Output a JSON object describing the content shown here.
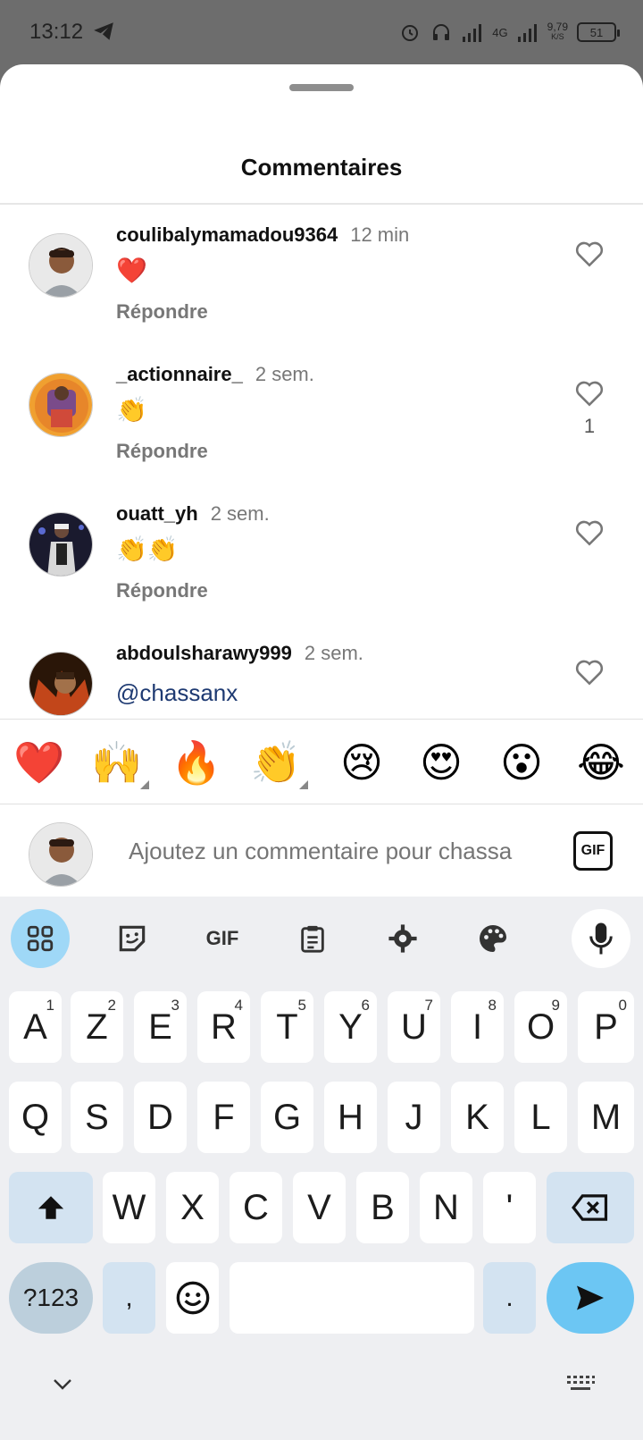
{
  "status_bar": {
    "time": "13:12",
    "network": "4G",
    "speed_value": "9,79",
    "speed_unit": "K/S",
    "battery": "51"
  },
  "sheet": {
    "title": "Commentaires"
  },
  "comments": [
    {
      "user": "coulibalymamadou9364",
      "time": "12 min",
      "text": "❤️",
      "reply": "Répondre",
      "likes": ""
    },
    {
      "user": "_actionnaire_",
      "time": "2 sem.",
      "text": "👏",
      "reply": "Répondre",
      "likes": "1"
    },
    {
      "user": "ouatt_yh",
      "time": "2 sem.",
      "text": "👏👏",
      "reply": "Répondre",
      "likes": ""
    },
    {
      "user": "abdoulsharawy999",
      "time": "2 sem.",
      "text": "@chassanx",
      "reply": "",
      "likes": ""
    }
  ],
  "emoji_bar": [
    "❤️",
    "🙌",
    "🔥",
    "👏",
    "😢",
    "😍",
    "😮",
    "😂"
  ],
  "composer": {
    "placeholder": "Ajoutez un commentaire pour chassa",
    "gif_label": "GIF"
  },
  "keyboard": {
    "toolbar_gif": "GIF",
    "row1": [
      {
        "k": "A",
        "n": "1"
      },
      {
        "k": "Z",
        "n": "2"
      },
      {
        "k": "E",
        "n": "3"
      },
      {
        "k": "R",
        "n": "4"
      },
      {
        "k": "T",
        "n": "5"
      },
      {
        "k": "Y",
        "n": "6"
      },
      {
        "k": "U",
        "n": "7"
      },
      {
        "k": "I",
        "n": "8"
      },
      {
        "k": "O",
        "n": "9"
      },
      {
        "k": "P",
        "n": "0"
      }
    ],
    "row2": [
      "Q",
      "S",
      "D",
      "F",
      "G",
      "H",
      "J",
      "K",
      "L",
      "M"
    ],
    "row3": [
      "W",
      "X",
      "C",
      "V",
      "B",
      "N",
      "'"
    ],
    "symbols_label": "?123",
    "comma": ",",
    "period": "."
  },
  "colors": {
    "reply_gray": "#777777",
    "mention_blue": "#1e3a72",
    "key_blue": "#6cc6f3"
  }
}
